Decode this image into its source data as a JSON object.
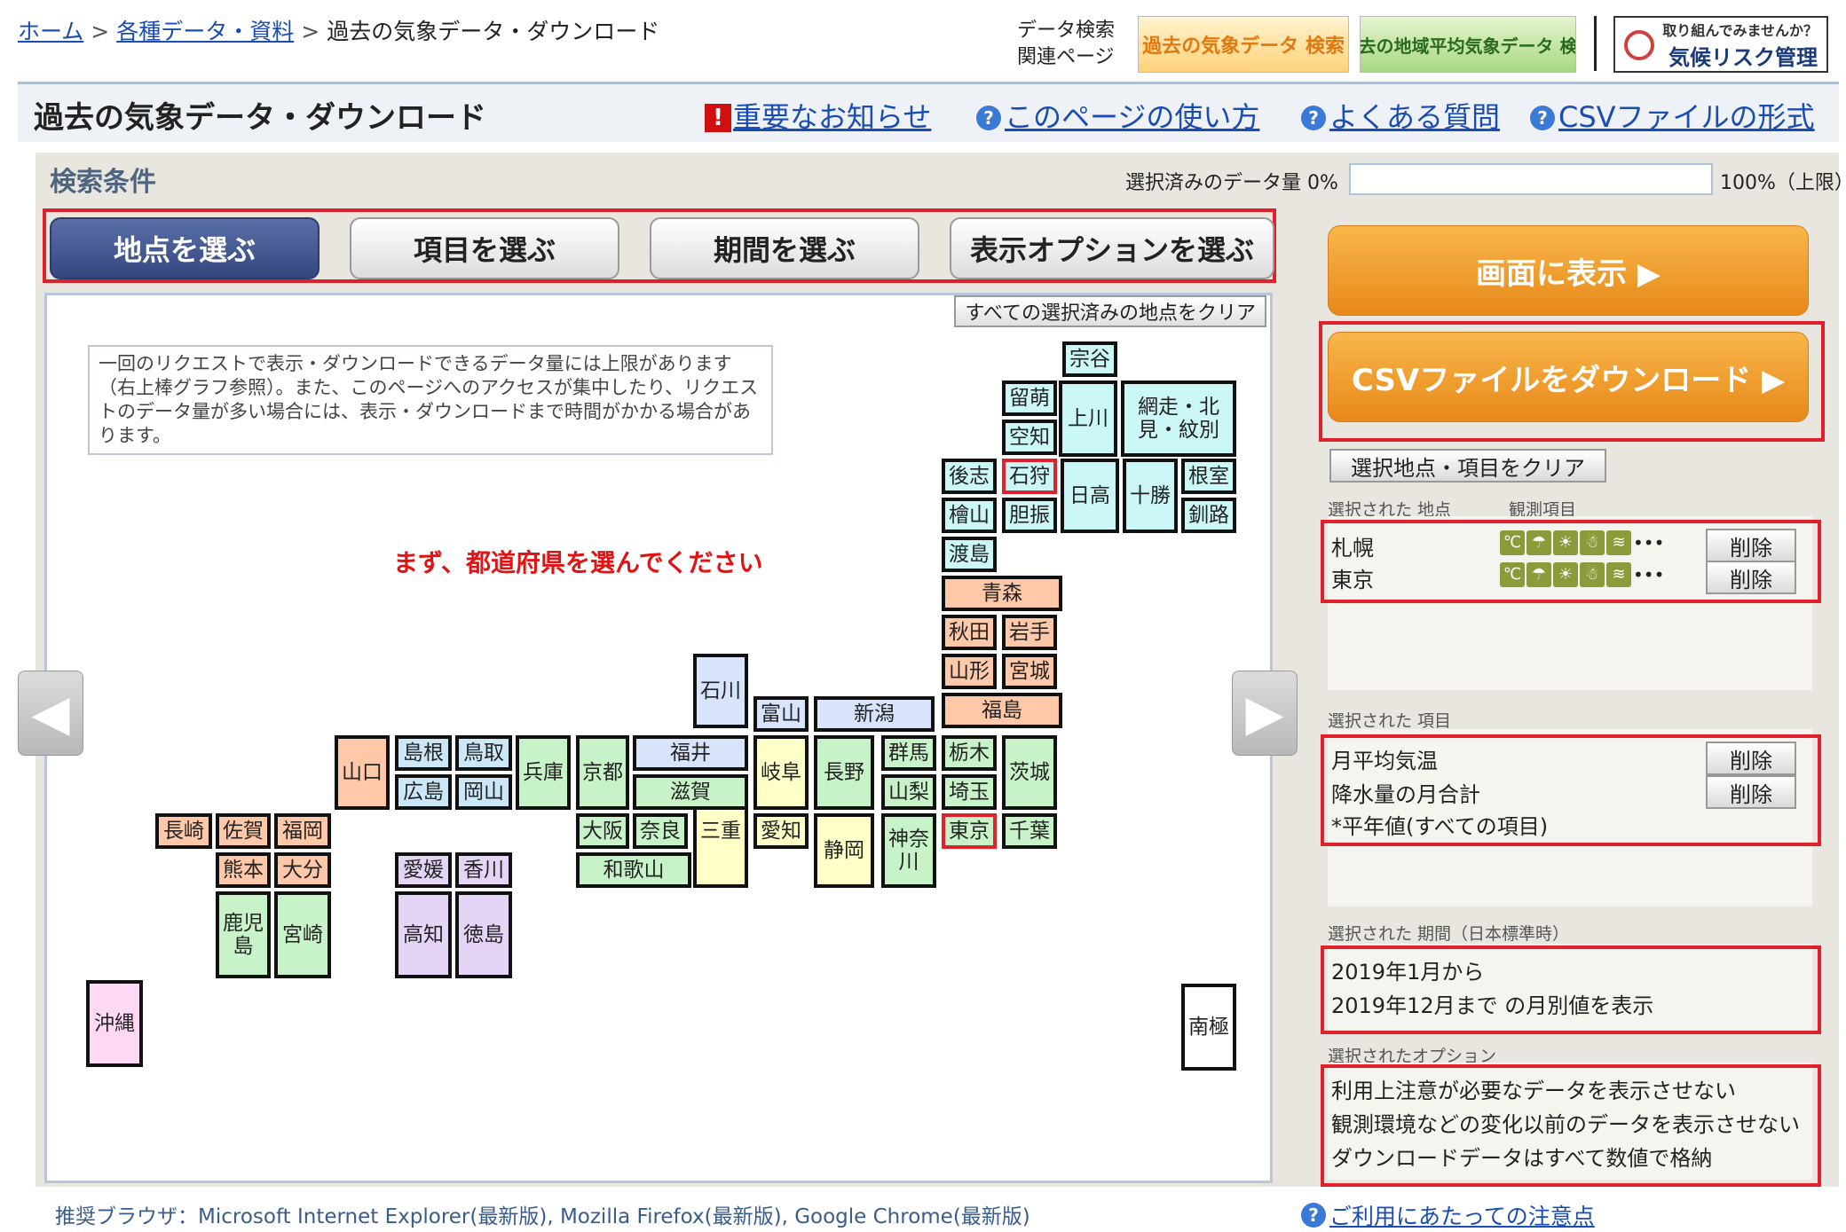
{
  "breadcrumb": {
    "home": "ホーム",
    "data": "各種データ・資料",
    "current": "過去の気象データ・ダウンロード"
  },
  "header": {
    "search_label_1": "データ検索",
    "search_label_2": "関連ページ",
    "banner_past": "過去の気象データ 検索",
    "banner_avg": "過去の地域平均気象データ 検索",
    "banner_risk_1": "取り組んでみませんか？",
    "banner_risk_2": "気候リスク管理"
  },
  "title": "過去の気象データ・ダウンロード",
  "links": {
    "notice": "重要なお知らせ",
    "howto": "このページの使い方",
    "faq": "よくある質問",
    "csv_format": "CSVファイルの形式"
  },
  "search": {
    "title": "検索条件",
    "qty_label": "選択済みのデータ量 0%",
    "qty_percent": 0,
    "qty_max": "100%（上限）"
  },
  "tabs": [
    "地点を選ぶ",
    "項目を選ぶ",
    "期間を選ぶ",
    "表示オプションを選ぶ"
  ],
  "map": {
    "clear_all": "すべての選択済みの地点をクリア",
    "notice": "一回のリクエストで表示・ダウンロードできるデータ量には上限があります（右上棒グラフ参照）。また、このページへのアクセスが集中したり、リクエストのデータ量が多い場合には、表示・ダウンロードまで時間がかかる場合があります。",
    "prompt": "まず、都道府県を選んでください"
  },
  "prefectures": [
    {
      "name": "宗谷",
      "color": "#ccf7f7",
      "sel": false
    },
    {
      "name": "留萌",
      "color": "#ccf7f7",
      "sel": false
    },
    {
      "name": "上川",
      "color": "#ccf7f7",
      "sel": false
    },
    {
      "name": "網走・北見・紋別",
      "color": "#ccf7f7",
      "sel": false
    },
    {
      "name": "空知",
      "color": "#ccf7f7",
      "sel": false
    },
    {
      "name": "後志",
      "color": "#ccf7f7",
      "sel": false
    },
    {
      "name": "石狩",
      "color": "#ccf7f7",
      "sel": true
    },
    {
      "name": "日高",
      "color": "#ccf7f7",
      "sel": false
    },
    {
      "name": "十勝",
      "color": "#ccf7f7",
      "sel": false
    },
    {
      "name": "根室",
      "color": "#ccf7f7",
      "sel": false
    },
    {
      "name": "檜山",
      "color": "#ccf7f7",
      "sel": false
    },
    {
      "name": "胆振",
      "color": "#ccf7f7",
      "sel": false
    },
    {
      "name": "釧路",
      "color": "#ccf7f7",
      "sel": false
    },
    {
      "name": "渡島",
      "color": "#ccf7f7",
      "sel": false
    },
    {
      "name": "青森",
      "color": "#ffc8a8",
      "sel": false
    },
    {
      "name": "秋田",
      "color": "#ffc8a8",
      "sel": false
    },
    {
      "name": "岩手",
      "color": "#ffc8a8",
      "sel": false
    },
    {
      "name": "山形",
      "color": "#ffc8a8",
      "sel": false
    },
    {
      "name": "宮城",
      "color": "#ffc8a8",
      "sel": false
    },
    {
      "name": "福島",
      "color": "#ffc8a8",
      "sel": false
    },
    {
      "name": "石川",
      "color": "#d8e4fb",
      "sel": false
    },
    {
      "name": "富山",
      "color": "#d8e4fb",
      "sel": false
    },
    {
      "name": "新潟",
      "color": "#d8e4fb",
      "sel": false
    },
    {
      "name": "群馬",
      "color": "#c8f2c8",
      "sel": false
    },
    {
      "name": "栃木",
      "color": "#c8f2c8",
      "sel": false
    },
    {
      "name": "茨城",
      "color": "#c8f2c8",
      "sel": false
    },
    {
      "name": "山梨",
      "color": "#c8f2c8",
      "sel": false
    },
    {
      "name": "埼玉",
      "color": "#c8f2c8",
      "sel": false
    },
    {
      "name": "東京",
      "color": "#c8f2c8",
      "sel": true
    },
    {
      "name": "千葉",
      "color": "#c8f2c8",
      "sel": false
    },
    {
      "name": "神奈川",
      "color": "#c8f2c8",
      "sel": false
    },
    {
      "name": "長野",
      "color": "#c8f2c8",
      "sel": false
    },
    {
      "name": "静岡",
      "color": "#ffffc8",
      "sel": false
    },
    {
      "name": "岐阜",
      "color": "#ffffc8",
      "sel": false
    },
    {
      "name": "愛知",
      "color": "#ffffc8",
      "sel": false
    },
    {
      "name": "三重",
      "color": "#ffffc8",
      "sel": false
    },
    {
      "name": "福井",
      "color": "#d8e4fb",
      "sel": false
    },
    {
      "name": "滋賀",
      "color": "#c8f2c8",
      "sel": false
    },
    {
      "name": "京都",
      "color": "#c8f2c8",
      "sel": false
    },
    {
      "name": "大阪",
      "color": "#c8f2c8",
      "sel": false
    },
    {
      "name": "奈良",
      "color": "#c8f2c8",
      "sel": false
    },
    {
      "name": "和歌山",
      "color": "#c8f2c8",
      "sel": false
    },
    {
      "name": "兵庫",
      "color": "#c8f2c8",
      "sel": false
    },
    {
      "name": "鳥取",
      "color": "#cce8f8",
      "sel": false
    },
    {
      "name": "岡山",
      "color": "#cce8f8",
      "sel": false
    },
    {
      "name": "島根",
      "color": "#cce8f8",
      "sel": false
    },
    {
      "name": "広島",
      "color": "#cce8f8",
      "sel": false
    },
    {
      "name": "山口",
      "color": "#ffc8a8",
      "sel": false
    },
    {
      "name": "香川",
      "color": "#e4d4f6",
      "sel": false
    },
    {
      "name": "愛媛",
      "color": "#e4d4f6",
      "sel": false
    },
    {
      "name": "徳島",
      "color": "#e4d4f6",
      "sel": false
    },
    {
      "name": "高知",
      "color": "#e4d4f6",
      "sel": false
    },
    {
      "name": "福岡",
      "color": "#ffc8a8",
      "sel": false
    },
    {
      "name": "佐賀",
      "color": "#ffc8a8",
      "sel": false
    },
    {
      "name": "長崎",
      "color": "#ffc8a8",
      "sel": false
    },
    {
      "name": "大分",
      "color": "#ffc8a8",
      "sel": false
    },
    {
      "name": "熊本",
      "color": "#ffc8a8",
      "sel": false
    },
    {
      "name": "宮崎",
      "color": "#c8f2c8",
      "sel": false
    },
    {
      "name": "鹿児島",
      "color": "#c8f2c8",
      "sel": false
    },
    {
      "name": "沖縄",
      "color": "#ffd8f6",
      "sel": false
    },
    {
      "name": "南極",
      "color": "#ffffff",
      "sel": false
    }
  ],
  "actions": {
    "show": "画面に表示 ▶",
    "csv": "CSVファイルをダウンロード ▶",
    "clear_selection": "選択地点・項目をクリア"
  },
  "selected_stations": {
    "label": "選択された 地点",
    "items_label": "観測項目",
    "rows": [
      {
        "name": "札幌",
        "delete": "削除"
      },
      {
        "name": "東京",
        "delete": "削除"
      }
    ]
  },
  "selected_items": {
    "label": "選択された 項目",
    "rows": [
      {
        "name": "月平均気温",
        "delete": "削除"
      },
      {
        "name": "降水量の月合計",
        "delete": "削除"
      }
    ],
    "note": "*平年値(すべての項目)"
  },
  "selected_period": {
    "label": "選択された 期間（日本標準時）",
    "from": "2019年1月から",
    "to": "2019年12月まで の月別値を表示"
  },
  "selected_options": {
    "label": "選択されたオプション",
    "rows": [
      "利用上注意が必要なデータを表示させない",
      "観測環境などの変化以前のデータを表示させない",
      "ダウンロードデータはすべて数値で格納"
    ]
  },
  "footer": {
    "browsers": "推奨ブラウザ：Microsoft Internet Explorer(最新版), Mozilla Firefox(最新版), Google Chrome(最新版)",
    "notes": "ご利用にあたっての注意点"
  }
}
